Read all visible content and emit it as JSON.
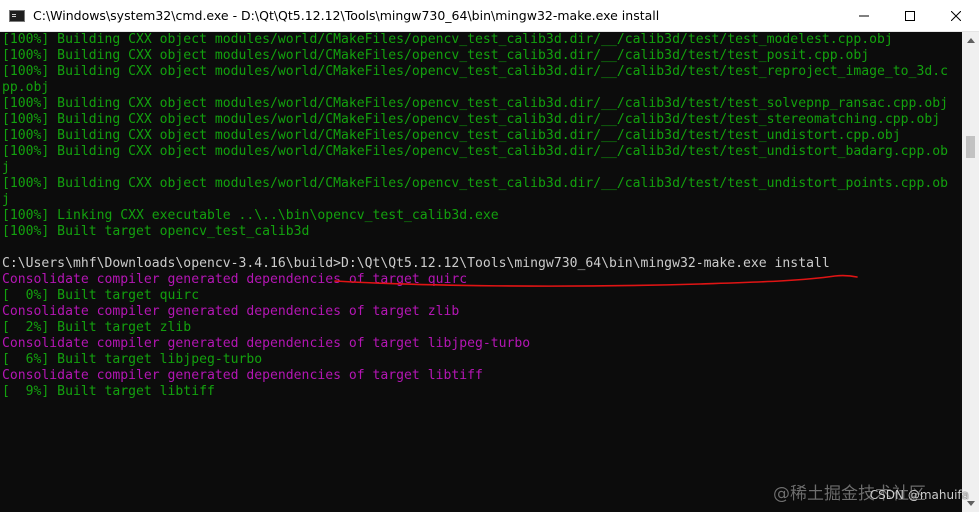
{
  "window": {
    "title": "C:\\Windows\\system32\\cmd.exe - D:\\Qt\\Qt5.12.12\\Tools\\mingw730_64\\bin\\mingw32-make.exe  install",
    "controls": {
      "minimize": "minimize-icon",
      "maximize": "maximize-icon",
      "close": "close-icon"
    }
  },
  "colors": {
    "background": "#0c0c0c",
    "green": "#13a10e",
    "gray": "#cccccc",
    "magenta": "#b416b4",
    "annotation_red": "#e01414"
  },
  "console": {
    "lines": [
      {
        "text": "[100%] Building CXX object modules/world/CMakeFiles/opencv_test_calib3d.dir/__/calib3d/test/test_modelest.cpp.obj",
        "color": "green"
      },
      {
        "text": "[100%] Building CXX object modules/world/CMakeFiles/opencv_test_calib3d.dir/__/calib3d/test/test_posit.cpp.obj",
        "color": "green"
      },
      {
        "text": "[100%] Building CXX object modules/world/CMakeFiles/opencv_test_calib3d.dir/__/calib3d/test/test_reproject_image_to_3d.c",
        "color": "green"
      },
      {
        "text": "pp.obj",
        "color": "green"
      },
      {
        "text": "[100%] Building CXX object modules/world/CMakeFiles/opencv_test_calib3d.dir/__/calib3d/test/test_solvepnp_ransac.cpp.obj",
        "color": "green"
      },
      {
        "text": "[100%] Building CXX object modules/world/CMakeFiles/opencv_test_calib3d.dir/__/calib3d/test/test_stereomatching.cpp.obj",
        "color": "green"
      },
      {
        "text": "[100%] Building CXX object modules/world/CMakeFiles/opencv_test_calib3d.dir/__/calib3d/test/test_undistort.cpp.obj",
        "color": "green"
      },
      {
        "text": "[100%] Building CXX object modules/world/CMakeFiles/opencv_test_calib3d.dir/__/calib3d/test/test_undistort_badarg.cpp.ob",
        "color": "green"
      },
      {
        "text": "j",
        "color": "green"
      },
      {
        "text": "[100%] Building CXX object modules/world/CMakeFiles/opencv_test_calib3d.dir/__/calib3d/test/test_undistort_points.cpp.ob",
        "color": "green"
      },
      {
        "text": "j",
        "color": "green"
      },
      {
        "text": "[100%] Linking CXX executable ..\\..\\bin\\opencv_test_calib3d.exe",
        "color": "green"
      },
      {
        "text": "[100%] Built target opencv_test_calib3d",
        "color": "green"
      },
      {
        "text": "",
        "color": "gray"
      },
      {
        "text": "C:\\Users\\mhf\\Downloads\\opencv-3.4.16\\build>D:\\Qt\\Qt5.12.12\\Tools\\mingw730_64\\bin\\mingw32-make.exe install",
        "color": "gray"
      },
      {
        "text": "Consolidate compiler generated dependencies of target quirc",
        "color": "magenta"
      },
      {
        "text": "[  0%] Built target quirc",
        "color": "green"
      },
      {
        "text": "Consolidate compiler generated dependencies of target zlib",
        "color": "magenta"
      },
      {
        "text": "[  2%] Built target zlib",
        "color": "green"
      },
      {
        "text": "Consolidate compiler generated dependencies of target libjpeg-turbo",
        "color": "magenta"
      },
      {
        "text": "[  6%] Built target libjpeg-turbo",
        "color": "green"
      },
      {
        "text": "Consolidate compiler generated dependencies of target libtiff",
        "color": "magenta"
      },
      {
        "text": "[  9%] Built target libtiff",
        "color": "green"
      }
    ]
  },
  "scrollbar": {
    "up_icon": "scroll-up-arrow-icon",
    "down_icon": "scroll-down-arrow-icon"
  },
  "watermark": {
    "text": "CSDN @mahuifa",
    "faint_text": "@稀土掘金技术社区"
  }
}
